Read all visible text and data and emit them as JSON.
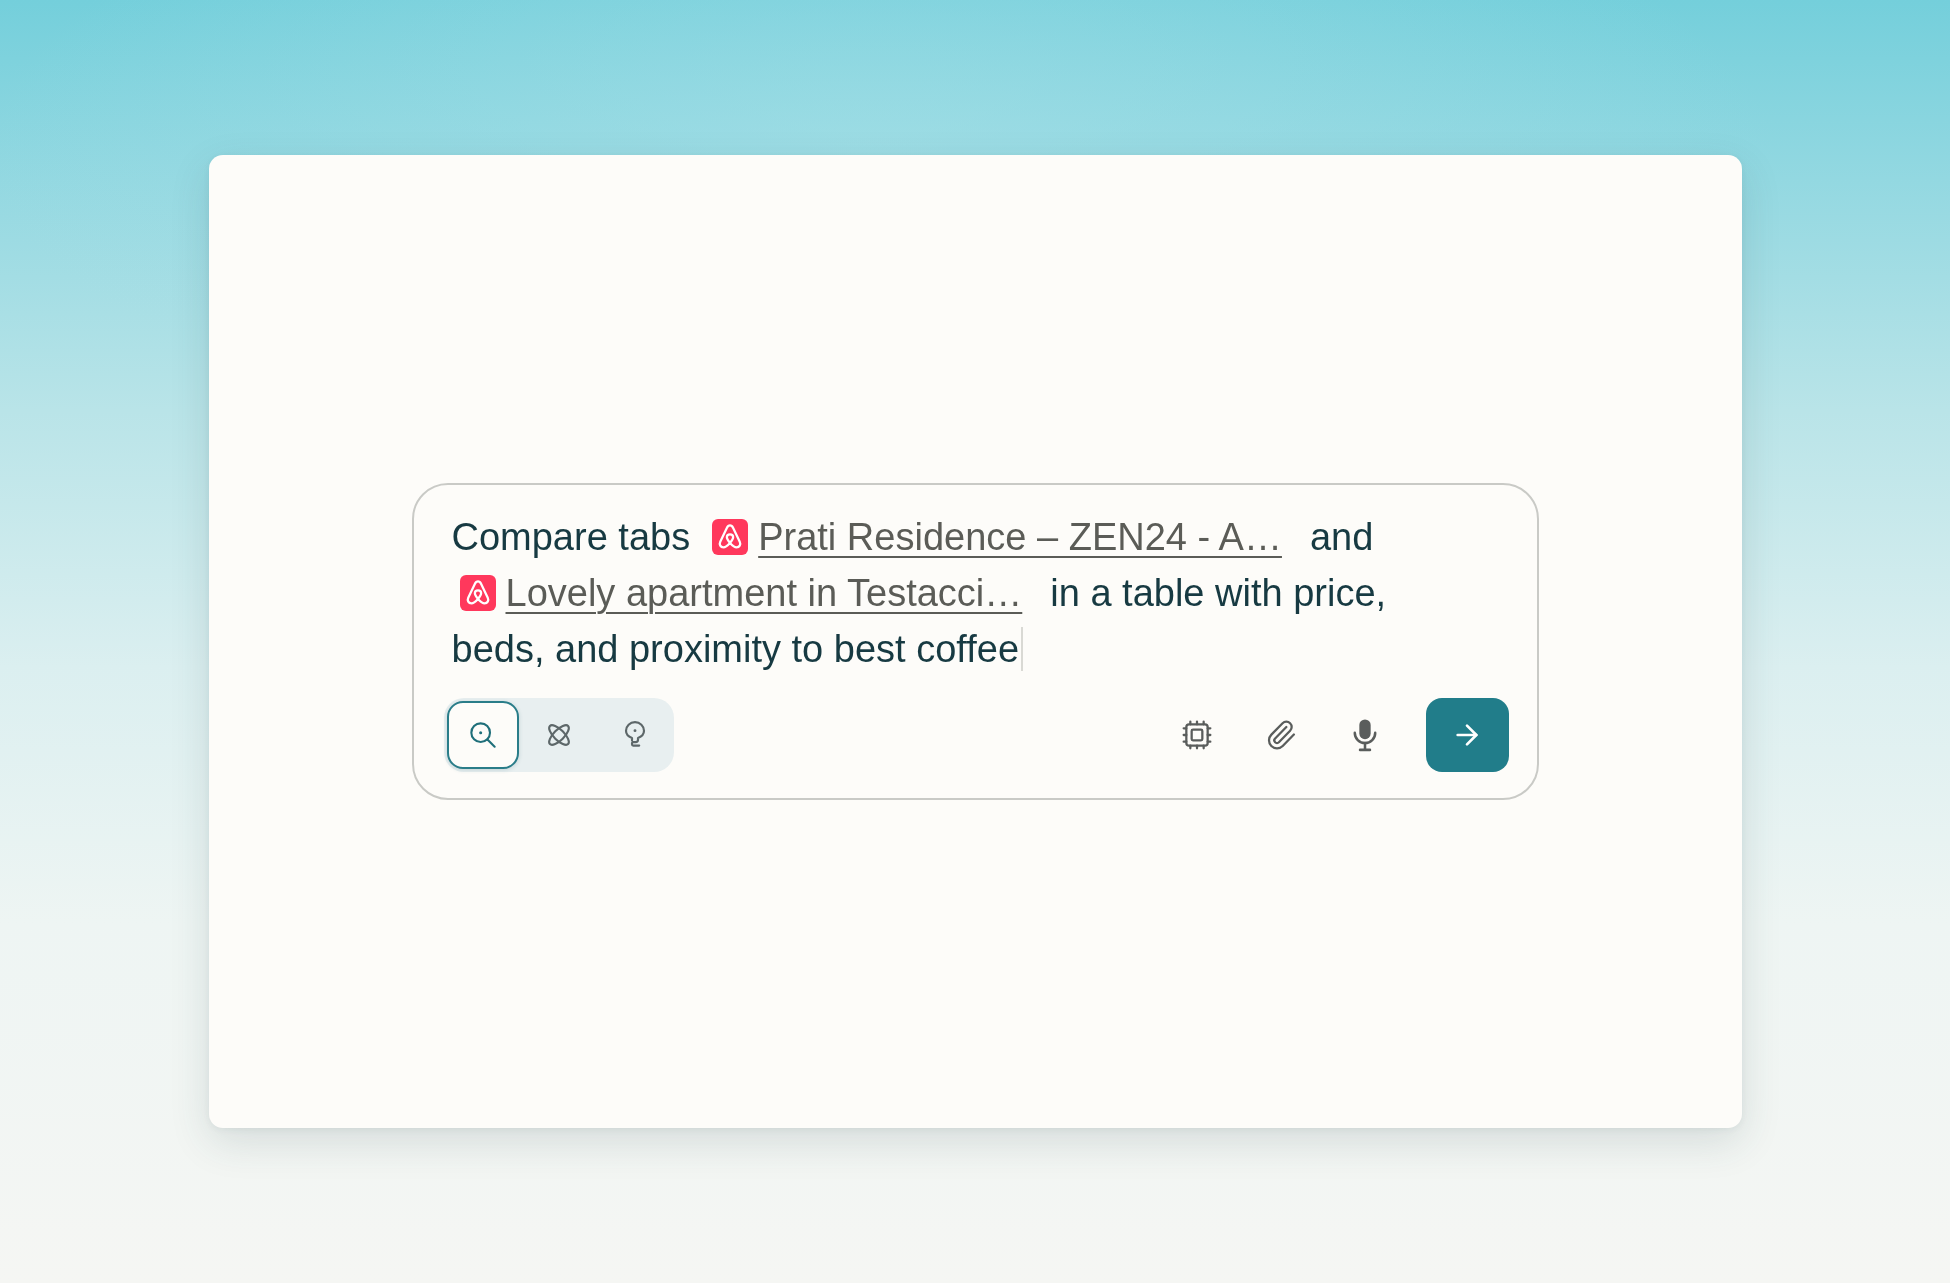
{
  "prompt": {
    "focused": true,
    "lines": [
      [
        {
          "kind": "text",
          "text": "Compare tabs"
        },
        {
          "kind": "tab",
          "title": "Prati Residence – ZEN24 - A…"
        },
        {
          "kind": "text",
          "text": "and"
        }
      ],
      [
        {
          "kind": "tab",
          "title": "Lovely apartment in Testacci…"
        },
        {
          "kind": "text",
          "text": "in a table with price,"
        }
      ],
      [
        {
          "kind": "text",
          "text": "beds, and proximity to best coffee"
        }
      ]
    ]
  },
  "modes": [
    {
      "kind": "search",
      "selected": true
    },
    {
      "kind": "research",
      "selected": false
    },
    {
      "kind": "ideas",
      "selected": false
    }
  ]
}
